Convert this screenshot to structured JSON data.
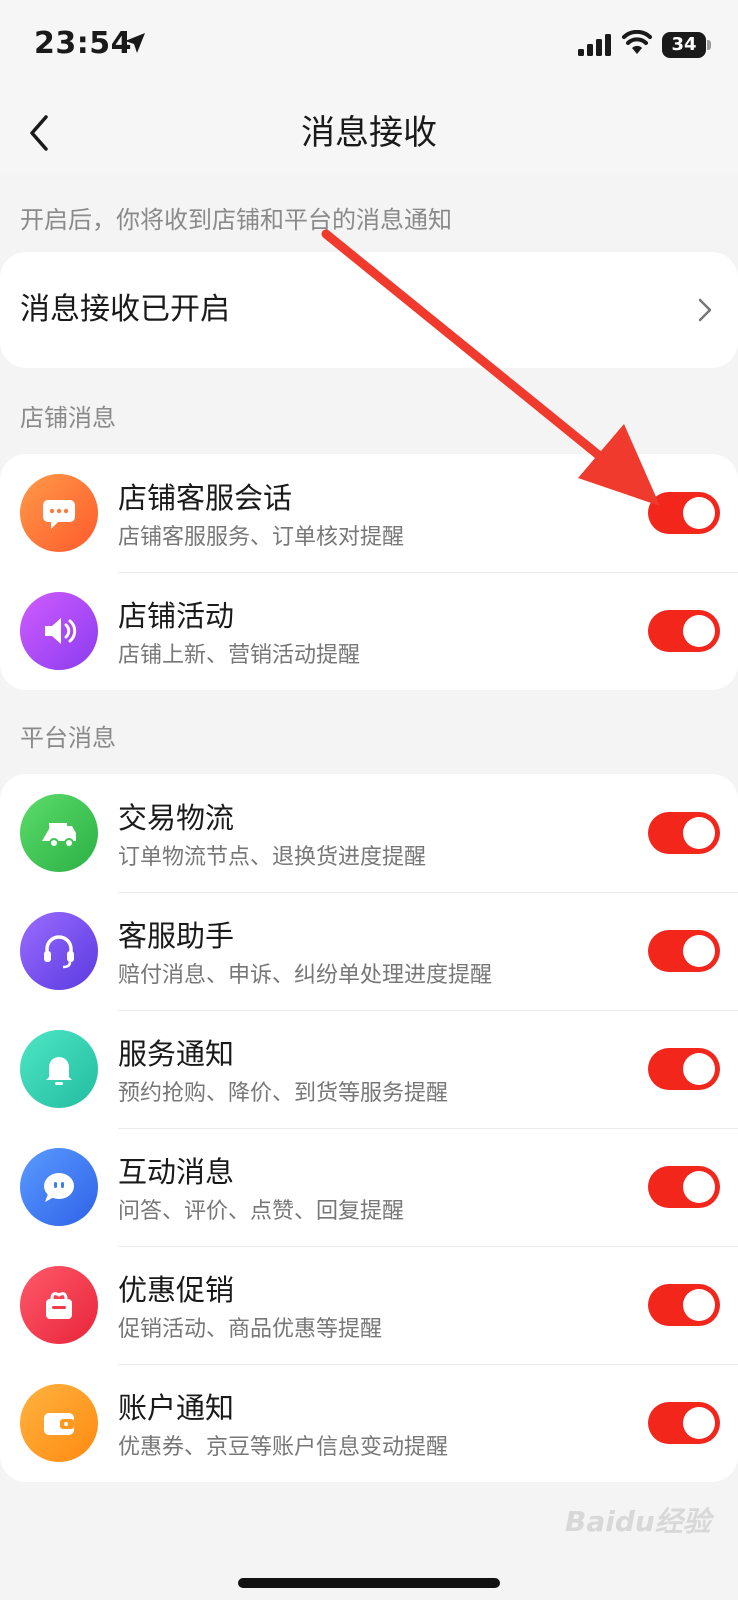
{
  "status_bar": {
    "time": "23:54",
    "battery": "34"
  },
  "nav": {
    "title": "消息接收"
  },
  "hint": "开启后，你将收到店铺和平台的消息通知",
  "master": {
    "label": "消息接收已开启"
  },
  "sections": {
    "store": {
      "title": "店铺消息",
      "items": [
        {
          "title": "店铺客服会话",
          "desc": "店铺客服服务、订单核对提醒",
          "icon": "chat-bubble-icon",
          "color": "#ff7a3d",
          "on": true
        },
        {
          "title": "店铺活动",
          "desc": "店铺上新、营销活动提醒",
          "icon": "speaker-icon",
          "color": "#b24bf0",
          "on": true
        }
      ]
    },
    "platform": {
      "title": "平台消息",
      "items": [
        {
          "title": "交易物流",
          "desc": "订单物流节点、退换货进度提醒",
          "icon": "truck-icon",
          "color": "#3ec552",
          "on": true
        },
        {
          "title": "客服助手",
          "desc": "赔付消息、申诉、纠纷单处理进度提醒",
          "icon": "headset-icon",
          "color": "#7b4ff0",
          "on": true
        },
        {
          "title": "服务通知",
          "desc": "预约抢购、降价、到货等服务提醒",
          "icon": "bell-icon",
          "color": "#2fd0b0",
          "on": true
        },
        {
          "title": "互动消息",
          "desc": "问答、评价、点赞、回复提醒",
          "icon": "message-icon",
          "color": "#3d7cf5",
          "on": true
        },
        {
          "title": "优惠促销",
          "desc": "促销活动、商品优惠等提醒",
          "icon": "gift-icon",
          "color": "#f23a4a",
          "on": true
        },
        {
          "title": "账户通知",
          "desc": "优惠券、京豆等账户信息变动提醒",
          "icon": "wallet-icon",
          "color": "#ff9a1f",
          "on": true
        }
      ]
    }
  },
  "colors": {
    "accent": "#f2261b",
    "annotation_arrow": "#f03a2e"
  },
  "watermark": "Baidu经验"
}
